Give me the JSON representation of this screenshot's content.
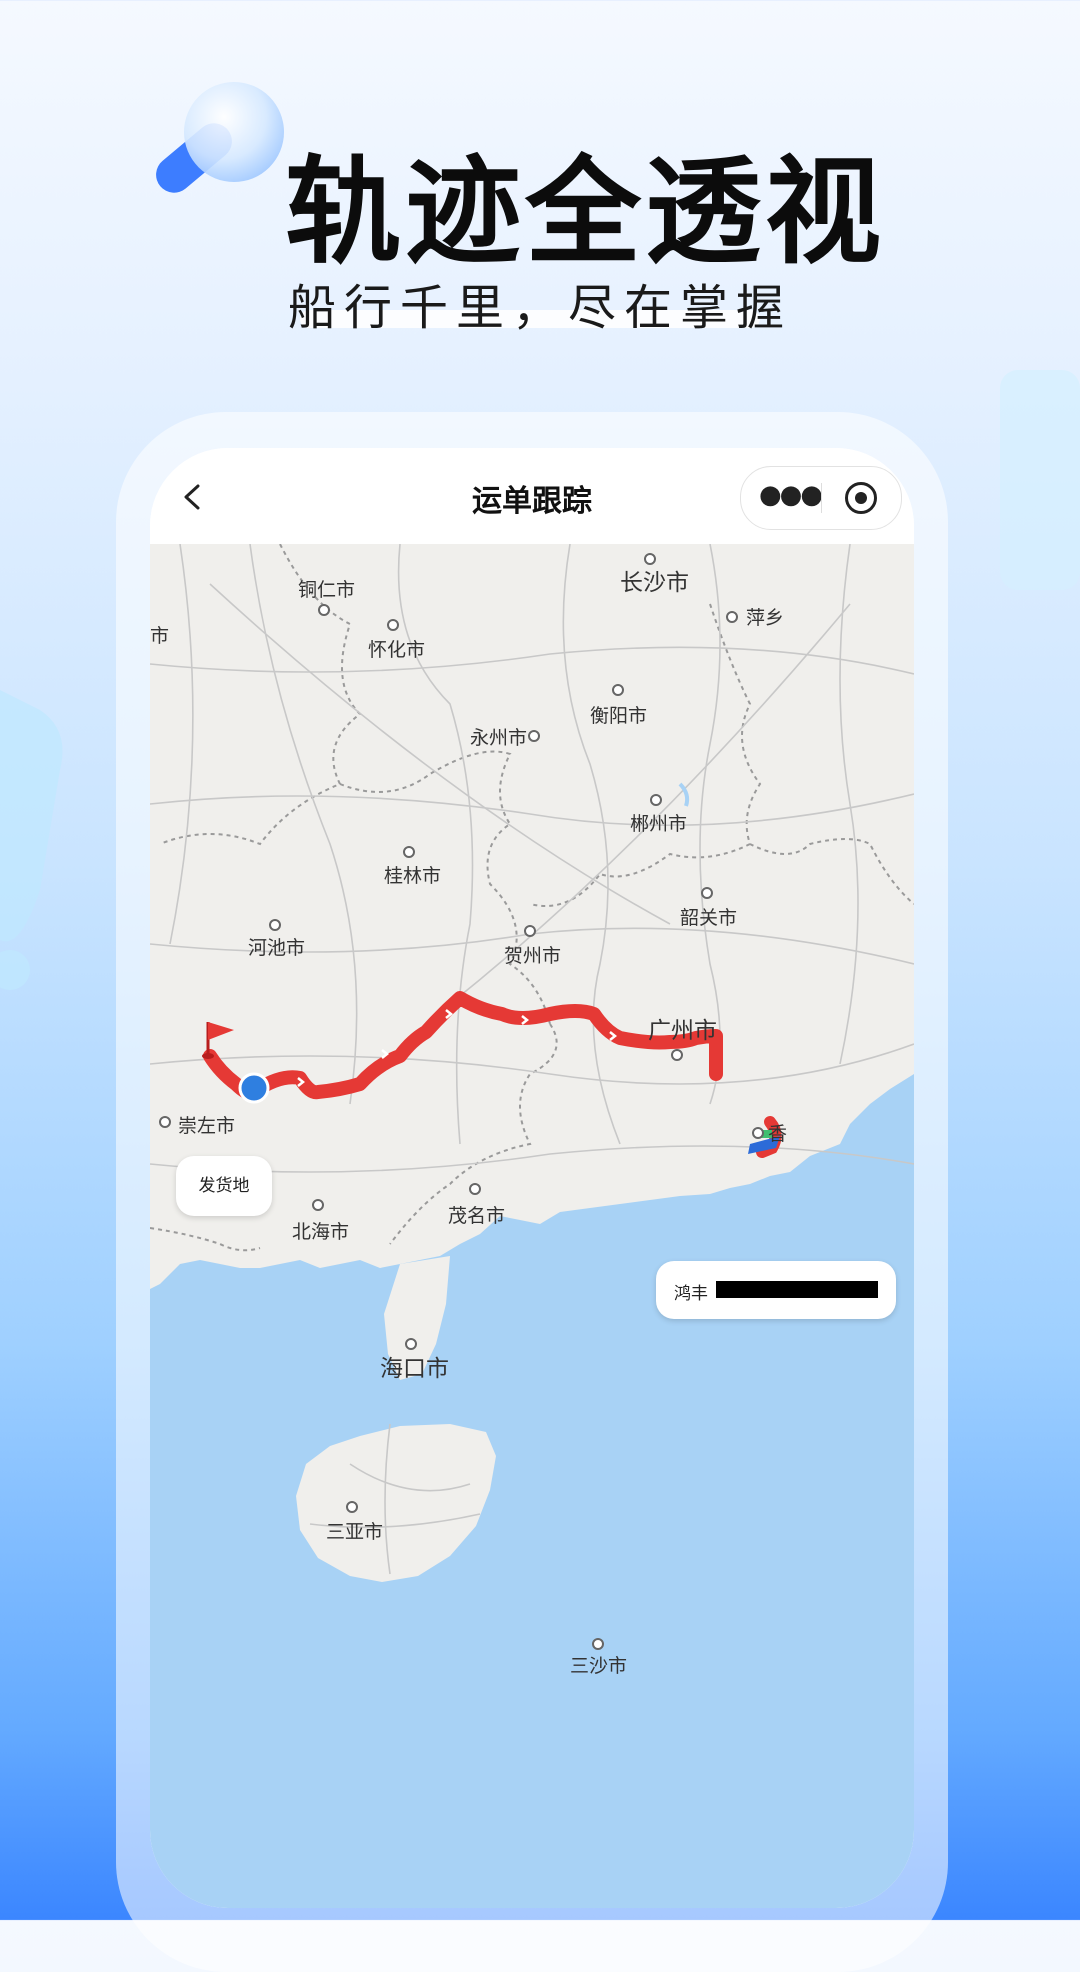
{
  "hero": {
    "title": "轨迹全透视",
    "subtitle": "船行千里，尽在掌握"
  },
  "nav": {
    "back_icon": "chevron-left-icon",
    "title": "运单跟踪",
    "more_icon": "more-dots-icon",
    "close_icon": "target-icon"
  },
  "map": {
    "cities": [
      {
        "name": "铜仁市"
      },
      {
        "name": "长沙市"
      },
      {
        "name": "萍乡"
      },
      {
        "name": "怀化市"
      },
      {
        "name": "市"
      },
      {
        "name": "衡阳市"
      },
      {
        "name": "永州市"
      },
      {
        "name": "郴州市"
      },
      {
        "name": "桂林市"
      },
      {
        "name": "韶关市"
      },
      {
        "name": "河池市"
      },
      {
        "name": "贺州市"
      },
      {
        "name": "广州市"
      },
      {
        "name": "崇左市"
      },
      {
        "name": "香"
      },
      {
        "name": "北海市"
      },
      {
        "name": "茂名市"
      },
      {
        "name": "海口市"
      },
      {
        "name": "三亚市"
      },
      {
        "name": "三沙市"
      }
    ],
    "origin_bubble": "发货地",
    "dest_bubble_prefix": "鸿丰",
    "colors": {
      "route": "#e53935",
      "land": "#f0efec",
      "sea": "#a8d2f5",
      "current_position": "#2f7fe0"
    }
  }
}
